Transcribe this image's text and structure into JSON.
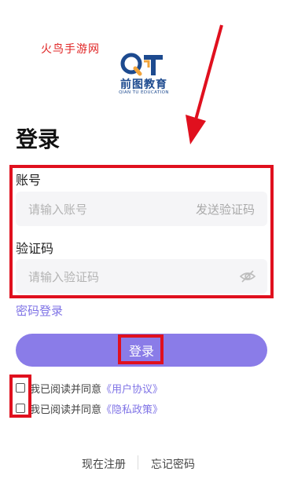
{
  "watermark": "火鸟手游网",
  "logo": {
    "name": "前图教育",
    "subtitle": "QIAN TU EDUCATION"
  },
  "page_title": "登录",
  "account": {
    "label": "账号",
    "placeholder": "请输入账号",
    "send_code": "发送验证码"
  },
  "code": {
    "label": "验证码",
    "placeholder": "请输入验证码"
  },
  "password_login": "密码登录",
  "login_button": "登录",
  "agreements": [
    {
      "prefix": "我已阅读并同意",
      "link": "《用户协议》"
    },
    {
      "prefix": "我已阅读并同意",
      "link": "《隐私政策》"
    }
  ],
  "footer": {
    "register": "现在注册",
    "forgot": "忘记密码"
  },
  "colors": {
    "accent": "#8a7ce8",
    "annotation": "#e0101e"
  }
}
